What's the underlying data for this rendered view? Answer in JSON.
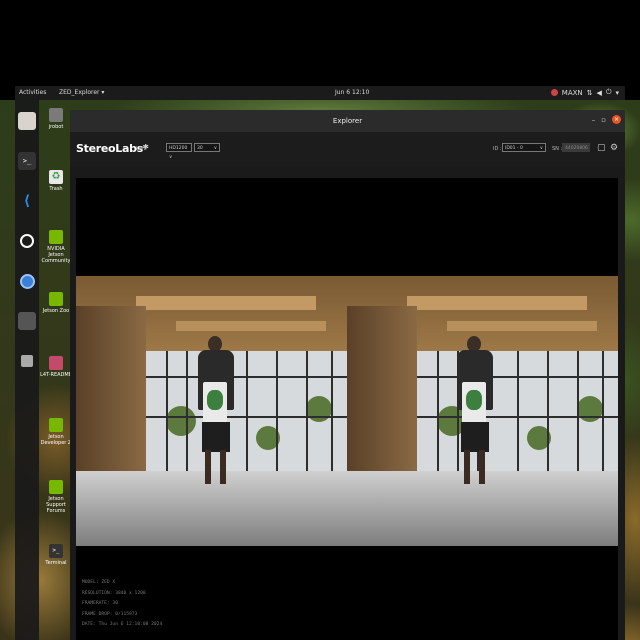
{
  "topbar": {
    "activities": "Activities",
    "app_menu": "ZED_Explorer ▾",
    "clock": "Jun 6 12:10",
    "power_mode": "MAXN"
  },
  "dock": {
    "items": [
      {
        "icon": "files-icon"
      },
      {
        "icon": "terminal-icon"
      },
      {
        "icon": "vscode-icon"
      },
      {
        "icon": "obs-icon"
      },
      {
        "icon": "chromium-icon"
      },
      {
        "icon": "drive-icon"
      }
    ]
  },
  "desktop_icons": [
    {
      "label": "jrobot",
      "icon": "home-folder-icon"
    },
    {
      "label": "Trash",
      "icon": "trash-icon"
    },
    {
      "label": "NVIDIA Jetson Community",
      "icon": "nvidia-icon"
    },
    {
      "label": "Jetson Zoo",
      "icon": "nvidia-icon"
    },
    {
      "label": "L4T-README",
      "icon": "folder-icon"
    },
    {
      "label": "Jetson Developer Z",
      "icon": "nvidia-icon"
    },
    {
      "label": "Jetson Support Forums",
      "icon": "nvidia-icon"
    },
    {
      "label": "Terminal",
      "icon": "terminal-icon"
    }
  ],
  "window": {
    "title": "Explorer"
  },
  "toolbar": {
    "logo": "StereoLabs*",
    "live": "LIVE",
    "resolution": "HD1200",
    "fps": "30",
    "id_label": "ID :",
    "camera_select": "ID01 - 0",
    "sn_label": "SN :",
    "serial": "44020806"
  },
  "info": {
    "model": "MODEL: ZED X",
    "resolution": "RESOLUTION: 3840 x 1200",
    "framerate": "FRAMERATE: 30",
    "frame_drop": "FRAME DROP: 0/115973",
    "date": "DATE: Thu Jun 6 12:10:08 2024"
  },
  "colors": {
    "accent_close": "#e95420",
    "window_bg": "#1a1a1a",
    "video_bg": "#000000"
  }
}
